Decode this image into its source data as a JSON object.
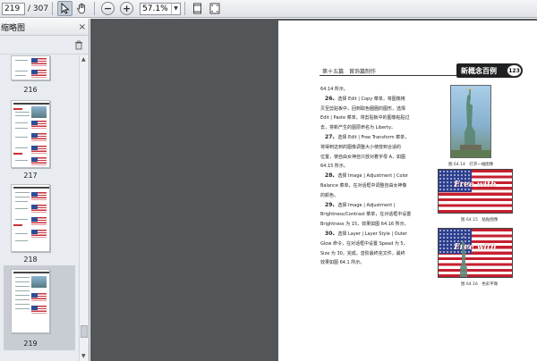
{
  "toolbar": {
    "current_page": "219",
    "total_pages": "/ 307",
    "zoom_value": "57.1%"
  },
  "sidebar": {
    "title": "缩略图",
    "thumbnails": [
      {
        "label": "216",
        "selected": false
      },
      {
        "label": "217",
        "selected": false
      },
      {
        "label": "218",
        "selected": false
      },
      {
        "label": "219",
        "selected": true
      }
    ]
  },
  "document": {
    "header_left": "第十五篇　首饰篇制作",
    "brand": "新概念百例",
    "page_number": "123",
    "intro": "64.14 所示。",
    "paragraphs": [
      {
        "step": "26、",
        "lines": [
          "选择 Edit | Copy 菜单，将图像拷",
          "贝至剪贴板中，回到取色圈圈的图形，选择",
          "Edit | Paste 菜单，将剪贴板中的图像粘贴过",
          "去，将新产生的图层命名为 Liberty。"
        ]
      },
      {
        "step": "27、",
        "lines": [
          "选择 Edit | Free Transform 菜单，",
          "将得到这到的图像调整大小使放到合适的",
          "位置，使自由女神自只放对着字母 A，如图",
          "64.15 所示。"
        ]
      },
      {
        "step": "28、",
        "lines": [
          "选择 Image | Adjustment | Color",
          "Balance 菜单，在对话框中调整自由女神像",
          "的颜色。"
        ]
      },
      {
        "step": "29、",
        "lines": [
          "选择 Image | Adjustment |",
          "Brightness/Contrast 菜单，在对话框中设置",
          "Brightness 为 15，效果如图 64.16 所示。"
        ]
      },
      {
        "step": "30、",
        "lines": [
          "选择 Layer | Layer Style | Outer",
          "Glow 命令，在对话框中设置 Spead 为 5，",
          "Size 为 30，完成，音阶最终完文件，最终",
          "效果如图 64.1 所示。"
        ]
      }
    ],
    "figures": [
      {
        "caption": "图 64.14　打开一幅图像"
      },
      {
        "caption": "图 64.15　粘贴图像",
        "flag_text": "Free with"
      },
      {
        "caption": "图 64.16　色彩平衡",
        "flag_text": "Free with"
      }
    ]
  },
  "colors": {
    "toolbar_bg": "#e6e9ee",
    "doc_bg": "#525659",
    "brand_bg": "#1f2022",
    "flag_red": "#c51f2f",
    "flag_blue": "#2c3f8f"
  }
}
